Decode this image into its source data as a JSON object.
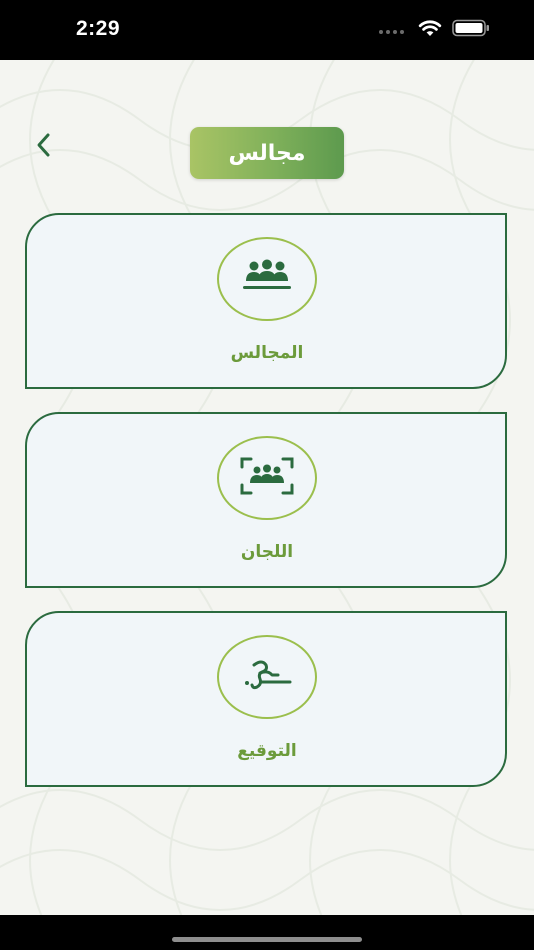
{
  "status_bar": {
    "time": "2:29",
    "icons": [
      "cellular-signal-icon",
      "wifi-icon",
      "battery-icon"
    ]
  },
  "header": {
    "title": "مجالس",
    "back_icon": "chevron-left-icon"
  },
  "cards": [
    {
      "label": "المجالس",
      "icon": "group-people-icon"
    },
    {
      "label": "اللجان",
      "icon": "committee-scan-icon"
    },
    {
      "label": "التوقيع",
      "icon": "signature-icon"
    }
  ],
  "colors": {
    "primary_green": "#2b6b3f",
    "label_green": "#6c9b3b",
    "ring_green": "#9bbf4d",
    "title_gradient_start": "#a9c465",
    "title_gradient_end": "#5d9a4e",
    "card_background": "#f1f6f9",
    "page_background": "#f4f5f1"
  }
}
